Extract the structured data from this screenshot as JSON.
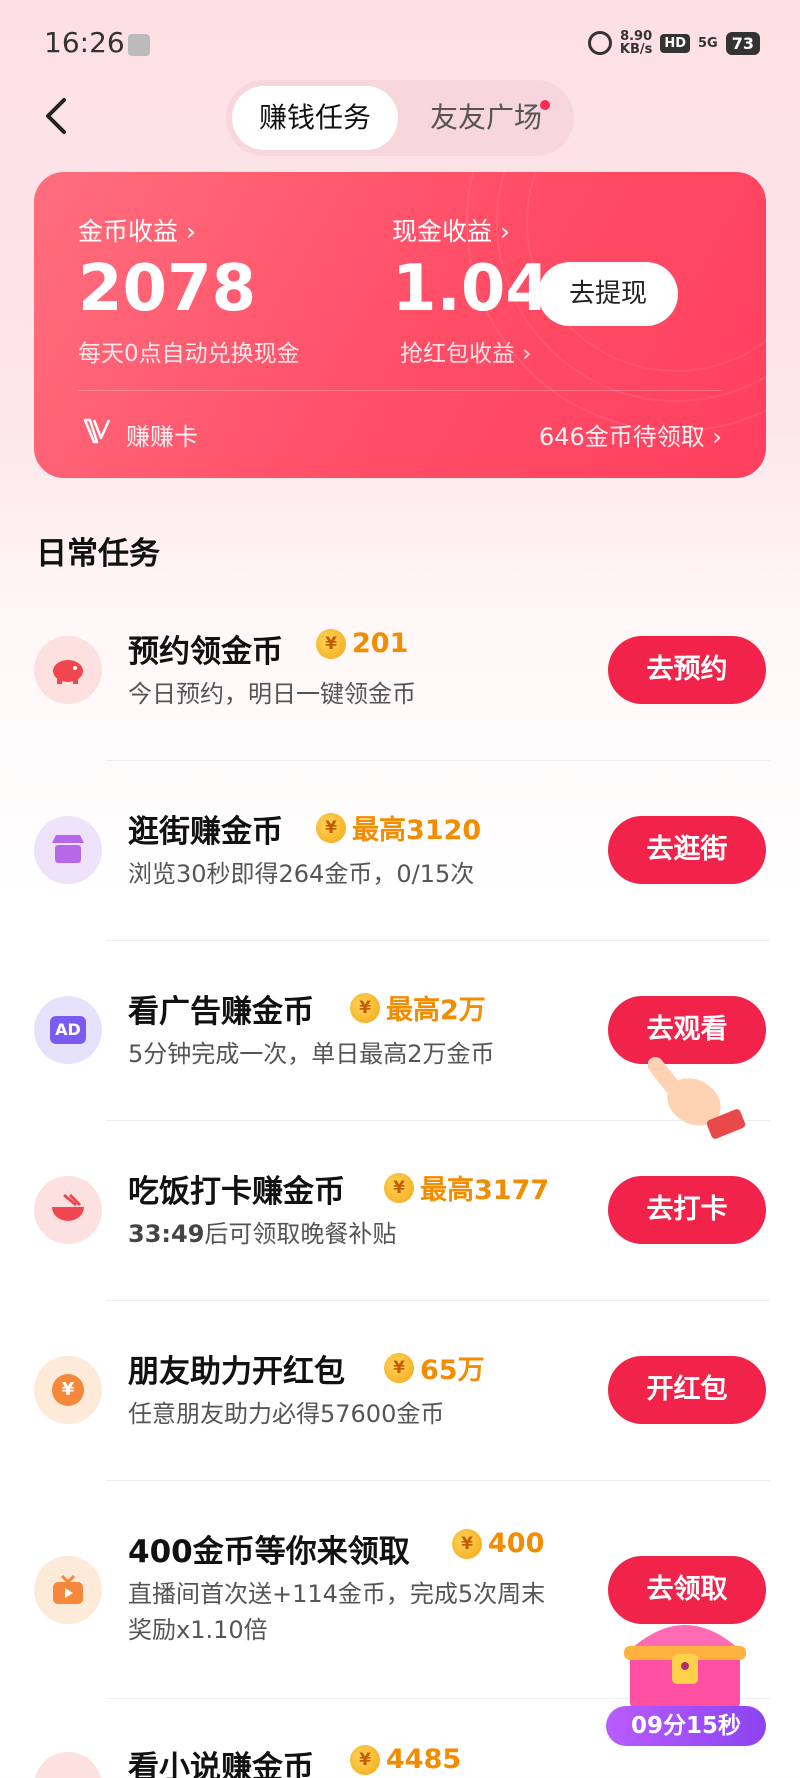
{
  "status": {
    "time": "16:26",
    "speed_value": "8.90",
    "speed_unit": "KB/s",
    "hd": "HD",
    "network": "5G",
    "battery": "73"
  },
  "tabs": [
    {
      "label": "赚钱任务"
    },
    {
      "label": "友友广场"
    }
  ],
  "earnings": {
    "coin_label": "金币收益 ›",
    "coin_value": "2078",
    "coin_sub": "每天0点自动兑换现金",
    "cash_label": "现金收益 ›",
    "cash_value": "1.04",
    "withdraw_label": "去提现",
    "cash_sub": "抢红包收益 ›",
    "card_label": "赚赚卡",
    "pending": "646金币待领取 ›"
  },
  "section_title": "日常任务",
  "tasks": [
    {
      "title": "预约领金币",
      "reward": "201",
      "desc": "今日预约，明日一键领金币",
      "button": "去预约",
      "icon": "piggy-bank-icon"
    },
    {
      "title": "逛街赚金币",
      "reward": "最高3120",
      "desc": "浏览30秒即得264金币，0/15次",
      "button": "去逛街",
      "icon": "shop-icon"
    },
    {
      "title": "看广告赚金币",
      "reward": "最高2万",
      "desc": "5分钟完成一次，单日最高2万金币",
      "button": "去观看",
      "icon": "ad-icon"
    },
    {
      "title": "吃饭打卡赚金币",
      "reward": "最高3177",
      "desc_strong": "33:49",
      "desc": "后可领取晚餐补贴",
      "button": "去打卡",
      "icon": "meal-bowl-icon"
    },
    {
      "title": "朋友助力开红包",
      "reward": "65万",
      "desc": "任意朋友助力必得57600金币",
      "button": "开红包",
      "icon": "yuan-coin-icon"
    },
    {
      "title": "400金币等你来领取",
      "reward": "400",
      "desc": "直播间首次送+114金币，完成5次周末",
      "desc2": "奖励x1.10倍",
      "button": "去领取",
      "icon": "tv-icon"
    },
    {
      "title": "看小说赚金币",
      "reward": "4485",
      "icon": "book-icon"
    }
  ],
  "float": {
    "timer": "09分15秒"
  },
  "colors": {
    "accent": "#f2234a",
    "reward": "#f28c00",
    "card": "#ff4d66"
  }
}
